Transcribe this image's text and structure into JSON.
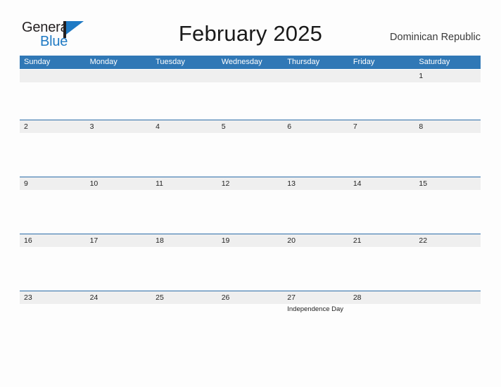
{
  "brand": {
    "word_one": "General",
    "word_two": "Blue",
    "mark": "flag-icon",
    "color_dark": "#231f20",
    "color_blue": "#1f7ac4"
  },
  "header": {
    "title": "February 2025",
    "region": "Dominican Republic"
  },
  "calendar": {
    "header_color": "#3078b6",
    "band_color": "#efefef",
    "rule_color": "#2a6ca8",
    "weekdays": [
      "Sunday",
      "Monday",
      "Tuesday",
      "Wednesday",
      "Thursday",
      "Friday",
      "Saturday"
    ],
    "weeks": [
      {
        "band_width": 655,
        "days": [
          {
            "number": "",
            "event": ""
          },
          {
            "number": "",
            "event": ""
          },
          {
            "number": "",
            "event": ""
          },
          {
            "number": "",
            "event": ""
          },
          {
            "number": "",
            "event": ""
          },
          {
            "number": "",
            "event": ""
          },
          {
            "number": "1",
            "event": ""
          }
        ]
      },
      {
        "band_width": 655,
        "days": [
          {
            "number": "2",
            "event": ""
          },
          {
            "number": "3",
            "event": ""
          },
          {
            "number": "4",
            "event": ""
          },
          {
            "number": "5",
            "event": ""
          },
          {
            "number": "6",
            "event": ""
          },
          {
            "number": "7",
            "event": ""
          },
          {
            "number": "8",
            "event": ""
          }
        ]
      },
      {
        "band_width": 655,
        "days": [
          {
            "number": "9",
            "event": ""
          },
          {
            "number": "10",
            "event": ""
          },
          {
            "number": "11",
            "event": ""
          },
          {
            "number": "12",
            "event": ""
          },
          {
            "number": "13",
            "event": ""
          },
          {
            "number": "14",
            "event": ""
          },
          {
            "number": "15",
            "event": ""
          }
        ]
      },
      {
        "band_width": 655,
        "days": [
          {
            "number": "16",
            "event": ""
          },
          {
            "number": "17",
            "event": ""
          },
          {
            "number": "18",
            "event": ""
          },
          {
            "number": "19",
            "event": ""
          },
          {
            "number": "20",
            "event": ""
          },
          {
            "number": "21",
            "event": ""
          },
          {
            "number": "22",
            "event": ""
          }
        ]
      },
      {
        "band_width": 655,
        "days": [
          {
            "number": "23",
            "event": ""
          },
          {
            "number": "24",
            "event": ""
          },
          {
            "number": "25",
            "event": ""
          },
          {
            "number": "26",
            "event": ""
          },
          {
            "number": "27",
            "event": "Independence Day"
          },
          {
            "number": "28",
            "event": ""
          },
          {
            "number": "",
            "event": ""
          }
        ]
      }
    ]
  }
}
